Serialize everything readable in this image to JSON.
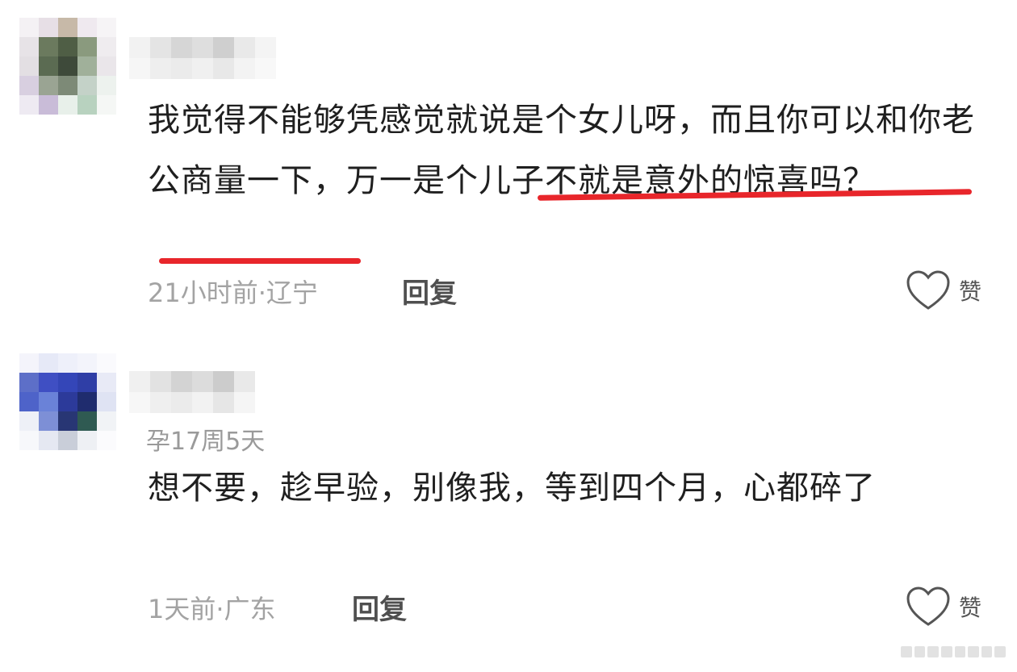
{
  "comments": [
    {
      "text_before": "我觉得不能够凭感觉就说是个女儿呀，而且你可以和你老公商量一下，",
      "text_highlight": "万一是个儿子不就是意外的惊喜吗？",
      "time": "21小时前",
      "sep": "·",
      "location": "辽宁",
      "reply_label": "回复",
      "like_label": "赞"
    },
    {
      "pregnancy": "孕17周5天",
      "text": "想不要，趁早验，别像我，等到四个月，心都碎了",
      "time": "1天前",
      "sep": "·",
      "location": "广东",
      "reply_label": "回复",
      "like_label": "赞"
    }
  ],
  "colors": {
    "underline": "#e8262b",
    "meta": "#a3a3a3",
    "text": "#1f1f1f"
  },
  "icons": {
    "like": "heart-outline-icon"
  }
}
